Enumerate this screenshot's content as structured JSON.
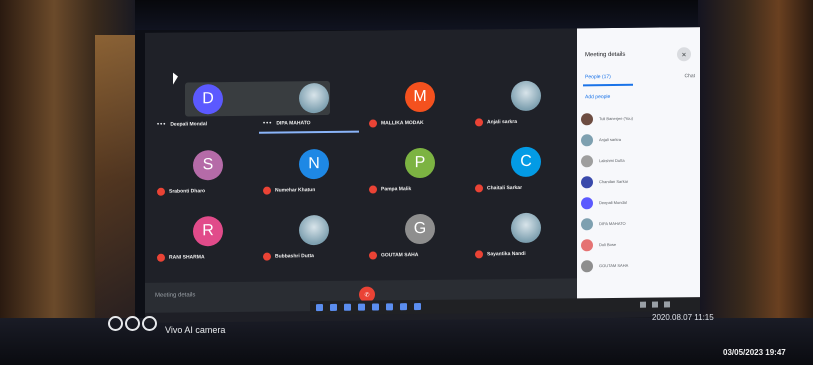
{
  "meeting": {
    "participants_grid": [
      {
        "name": "Deepali Mondal",
        "initial": "D",
        "color": "#5b59ff",
        "mic": "dots"
      },
      {
        "name": "DIPA MAHATO",
        "initial": "",
        "color": "#7ea0b0",
        "mic": "dots",
        "speaking": true
      },
      {
        "name": "MALLIKA MODAK",
        "initial": "M",
        "color": "#f4511e",
        "mic": "off"
      },
      {
        "name": "Anjali sarkra",
        "initial": "",
        "color": "#7ea0b0",
        "mic": "off"
      },
      {
        "name": "Srabonti Dharo",
        "initial": "S",
        "color": "#b56ba8",
        "mic": "off"
      },
      {
        "name": "Numehar Khatun",
        "initial": "N",
        "color": "#1e88e5",
        "mic": "off"
      },
      {
        "name": "Pampa Malik",
        "initial": "P",
        "color": "#7cb342",
        "mic": "off"
      },
      {
        "name": "Chaitali Sarkar",
        "initial": "C",
        "color": "#039be5",
        "mic": "off"
      },
      {
        "name": "RANI SHARMA",
        "initial": "R",
        "color": "#e14b8a",
        "mic": "off"
      },
      {
        "name": "Bubbashri Dutta",
        "initial": "",
        "color": "#9bb2bf",
        "mic": "off"
      },
      {
        "name": "GOUTAM SAHA",
        "initial": "G",
        "color": "#8e8e8e",
        "mic": "off"
      },
      {
        "name": "Sayantika Nandi",
        "initial": "",
        "color": "#a4a4a4",
        "mic": "off"
      }
    ],
    "controls": {
      "meeting_details_label": "Meeting details"
    }
  },
  "panel": {
    "title": "Meeting details",
    "close_icon": "×",
    "tabs": [
      {
        "label": "People (17)",
        "active": true
      },
      {
        "label": "Chat",
        "active": false
      }
    ],
    "add_people": "Add people",
    "participants": [
      {
        "name": "Tuli Banerjee (You)",
        "color": "#6d4c41"
      },
      {
        "name": "Anjali sarkra",
        "color": "#7ea0b0"
      },
      {
        "name": "Lakshmi Dutta",
        "color": "#9e9e9e"
      },
      {
        "name": "Chandan Sarkar",
        "color": "#3949ab"
      },
      {
        "name": "Deepali Mondal",
        "color": "#5b59ff"
      },
      {
        "name": "DIPA MAHATO",
        "color": "#7ea0b0"
      },
      {
        "name": "Doli Bose",
        "color": "#e57373"
      },
      {
        "name": "GOUTAM SAHA",
        "color": "#8e8e8e"
      }
    ]
  },
  "overlay": {
    "camera_brand": "Vivo AI camera",
    "shot_timestamp": "2020.08.07 11:15",
    "photo_date": "03/05/2023 19:47"
  }
}
